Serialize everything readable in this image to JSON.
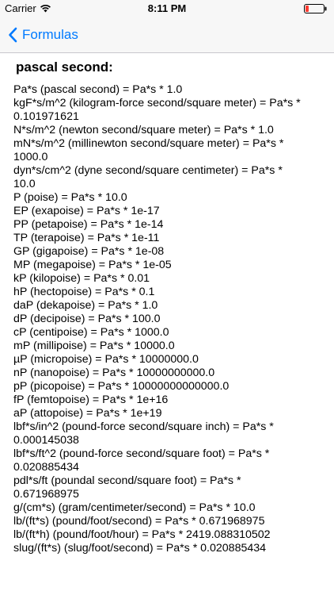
{
  "status_bar": {
    "carrier": "Carrier",
    "time": "8:11 PM",
    "wifi_icon": "wifi-icon",
    "battery_icon": "battery-low-icon",
    "battery_color": "#ff3b30"
  },
  "nav": {
    "back_label": "Formulas",
    "back_icon": "chevron-left-icon",
    "accent_color": "#007aff"
  },
  "page": {
    "title": "pascal second:"
  },
  "formulas": [
    "Pa*s (pascal second) = Pa*s * 1.0",
    "kgF*s/m^2 (kilogram-force second/square meter) = Pa*s *",
    "0.101971621",
    "N*s/m^2 (newton second/square meter) = Pa*s * 1.0",
    "mN*s/m^2 (millinewton second/square meter) = Pa*s *",
    "1000.0",
    "dyn*s/cm^2 (dyne second/square centimeter) = Pa*s *",
    "10.0",
    "P (poise) = Pa*s * 10.0",
    "EP (exapoise) = Pa*s * 1e-17",
    "PP (petapoise) = Pa*s * 1e-14",
    "TP (terapoise) = Pa*s * 1e-11",
    "GP (gigapoise) = Pa*s * 1e-08",
    "MP (megapoise) = Pa*s * 1e-05",
    "kP (kilopoise) = Pa*s * 0.01",
    "hP (hectopoise) = Pa*s * 0.1",
    "daP (dekapoise) = Pa*s * 1.0",
    "dP (decipoise) = Pa*s * 100.0",
    "cP (centipoise) = Pa*s * 1000.0",
    "mP (millipoise) = Pa*s * 10000.0",
    "µP (micropoise) = Pa*s * 10000000.0",
    "nP (nanopoise) = Pa*s * 10000000000.0",
    "pP (picopoise) = Pa*s * 10000000000000.0",
    "fP (femtopoise) = Pa*s * 1e+16",
    "aP (attopoise) = Pa*s * 1e+19",
    "lbf*s/in^2 (pound-force second/square inch) = Pa*s *",
    "0.000145038",
    "lbf*s/ft^2 (pound-force second/square foot) = Pa*s *",
    "0.020885434",
    "pdl*s/ft (poundal second/square foot) = Pa*s *",
    "0.671968975",
    "g/(cm*s) (gram/centimeter/second) = Pa*s * 10.0",
    "lb/(ft*s) (pound/foot/second) = Pa*s * 0.671968975",
    "lb/(ft*h) (pound/foot/hour) = Pa*s * 2419.088310502",
    "slug/(ft*s) (slug/foot/second) = Pa*s * 0.020885434"
  ]
}
